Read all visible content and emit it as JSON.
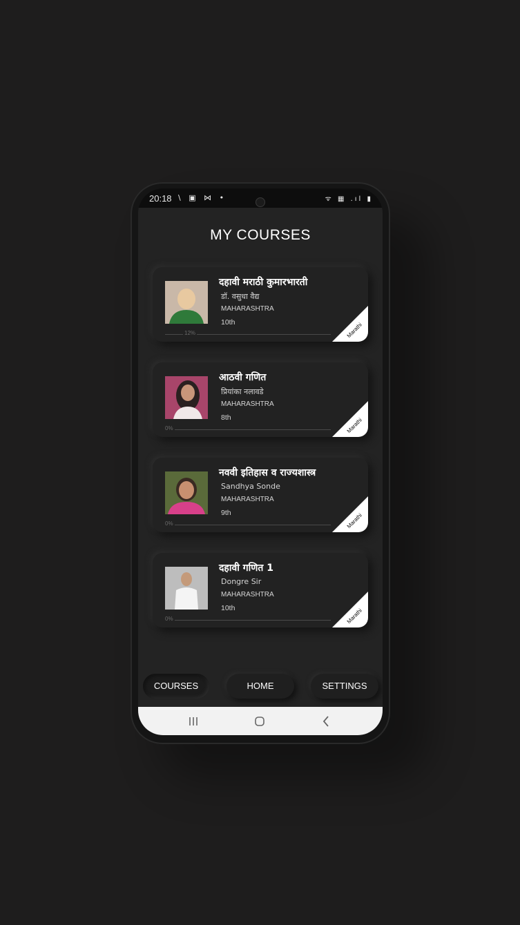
{
  "status_bar": {
    "time": "20:18",
    "left_icons": "\\ ▣ ⋈ •",
    "right_icons": "ᯤ ▦ .ıl ▮"
  },
  "page_title": "MY COURSES",
  "courses": [
    {
      "title": "दहावी मराठी कुमारभारती",
      "teacher": "डॉ. वसुधा वैद्य",
      "board": "MAHARASHTRA",
      "grade": "10th",
      "progress_label": "12%",
      "progress": 0.12,
      "language": "Marathi",
      "avatar_colors": [
        "#c9b8a8",
        "#2f7a3a",
        "#e8c9a0"
      ]
    },
    {
      "title": "आठवी गणित",
      "teacher": "प्रियांका नलावडे",
      "board": "MAHARASHTRA",
      "grade": "8th",
      "progress_label": "0%",
      "progress": 0,
      "language": "Marathi",
      "avatar_colors": [
        "#a8456a",
        "#2a2020",
        "#f0e8e8"
      ]
    },
    {
      "title": "नववी इतिहास व राज्यशास्त्र",
      "teacher": "Sandhya Sonde",
      "board": "MAHARASHTRA",
      "grade": "9th",
      "progress_label": "0%",
      "progress": 0,
      "language": "Marathi",
      "avatar_colors": [
        "#5a6a3a",
        "#d8408a",
        "#c89070"
      ]
    },
    {
      "title": "दहावी गणित 1",
      "teacher": "Dongre Sir",
      "board": "MAHARASHTRA",
      "grade": "10th",
      "progress_label": "0%",
      "progress": 0,
      "language": "Marathi",
      "avatar_colors": [
        "#bdbdbd",
        "#f4f4f4",
        "#c49a7a"
      ]
    }
  ],
  "bottom_nav": {
    "courses": "COURSES",
    "home": "HOME",
    "settings": "SETTINGS"
  },
  "colors": {
    "background": "#1e1d1d",
    "card": "#222222",
    "ribbon": "#ffffff",
    "text": "#ffffff"
  }
}
